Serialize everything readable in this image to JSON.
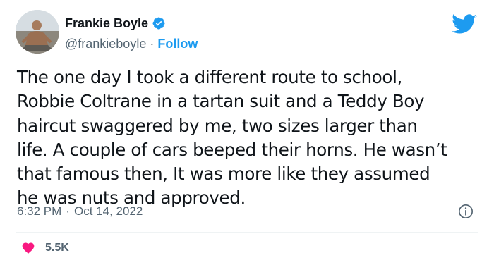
{
  "author": {
    "display_name": "Frankie Boyle",
    "handle": "@frankieboyle",
    "separator": "·",
    "follow_label": "Follow"
  },
  "tweet": {
    "text": "The one day I took a different route to school,\nRobbie Coltrane in a tartan suit and a Teddy Boy\nhaircut swaggered by me, two sizes larger than\nlife. A couple of cars beeped their horns. He wasn’t\nthat famous then, It was more like they assumed\nhe was nuts and approved.",
    "time": "6:32 PM",
    "date": "Oct 14, 2022",
    "meta_separator": "·"
  },
  "engagement": {
    "likes": "5.5K"
  },
  "icons": {
    "verified": "verified-badge-icon",
    "brand": "twitter-bird-icon",
    "info": "info-icon",
    "like": "heart-icon"
  },
  "colors": {
    "brand_blue": "#1d9bf0",
    "like_pink": "#f91880",
    "secondary_text": "#536471"
  }
}
